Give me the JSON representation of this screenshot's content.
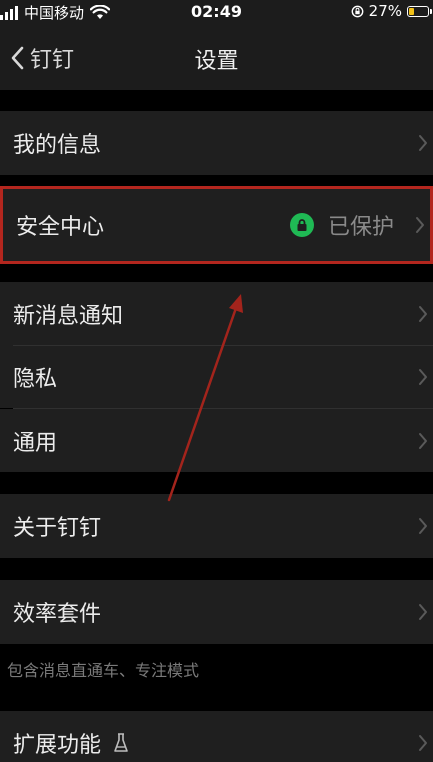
{
  "status_bar": {
    "carrier": "中国移动",
    "time": "02:49",
    "battery": "27%",
    "battery_level": 0.27
  },
  "nav": {
    "back_label": "钉钉",
    "title": "设置"
  },
  "rows": {
    "my_info": "我的信息",
    "security": "安全中心",
    "security_status": "已保护",
    "new_message": "新消息通知",
    "privacy": "隐私",
    "general": "通用",
    "about": "关于钉钉",
    "efficiency": "效率套件",
    "efficiency_note": "包含消息直通车、专注模式",
    "extensions": "扩展功能"
  },
  "colors": {
    "background": "#000000",
    "row": "#1f1f1f",
    "highlight_border": "#b3261e",
    "annotation_arrow": "#a3241c",
    "protected_green": "#1fb954"
  },
  "icons": {
    "back": "chevron-left-icon",
    "security_status": "lock-icon",
    "extensions": "flask-icon",
    "row_arrow": "chevron-right-icon"
  }
}
